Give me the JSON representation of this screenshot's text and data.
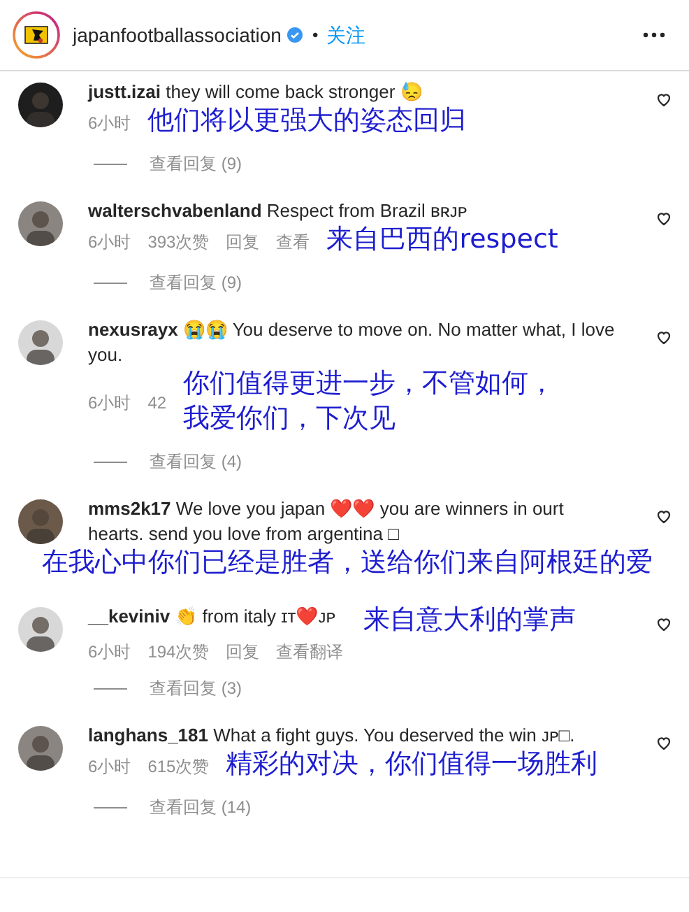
{
  "header": {
    "account": "japanfootballassociation",
    "separator": "•",
    "follow": "关注"
  },
  "comments": [
    {
      "username": "justt.izai",
      "text": "they will come back stronger 😓",
      "meta": [
        "6小时"
      ],
      "annotation": "他们将以更强大的姿态回归",
      "kind": "meta",
      "replies": "查看回复 (9)"
    },
    {
      "username": "walterschvabenland",
      "text": "Respect from Brazil ʙʀᴊᴘ",
      "meta": [
        "6小时",
        "393次赞",
        "回复",
        "查看"
      ],
      "annotation": "来自巴西的respect",
      "kind": "meta",
      "replies": "查看回复 (9)"
    },
    {
      "username": "nexusrayx",
      "text": "😭😭 You deserve to move on. No matter what, I love you.",
      "meta": [
        "6小时",
        "42"
      ],
      "annotation": "你们值得更进一步，不管如何，我爱你们，下次见",
      "kind": "meta",
      "replies": "查看回复 (4)"
    },
    {
      "username": "mms2k17",
      "text": "We love you japan ❤️❤️ you are winners in ourt hearts. send you love from argentina □",
      "annotation": "在我心中你们已经是胜者，送给你们来自阿根廷的爱",
      "kind": "below"
    },
    {
      "username": "__keviniv",
      "text": "👏 from italy ɪᴛ❤️ᴊᴘ",
      "meta": [
        "6小时",
        "194次赞",
        "回复",
        "查看翻译"
      ],
      "annotation": "来自意大利的掌声",
      "kind": "inline",
      "replies": "查看回复 (3)"
    },
    {
      "username": "langhans_181",
      "text": "What a fight guys. You deserved the win ᴊᴘ□.",
      "meta": [
        "6小时",
        "615次赞"
      ],
      "annotation": "精彩的对决，你们值得一场胜利",
      "kind": "meta",
      "replies": "查看回复 (14)"
    }
  ]
}
